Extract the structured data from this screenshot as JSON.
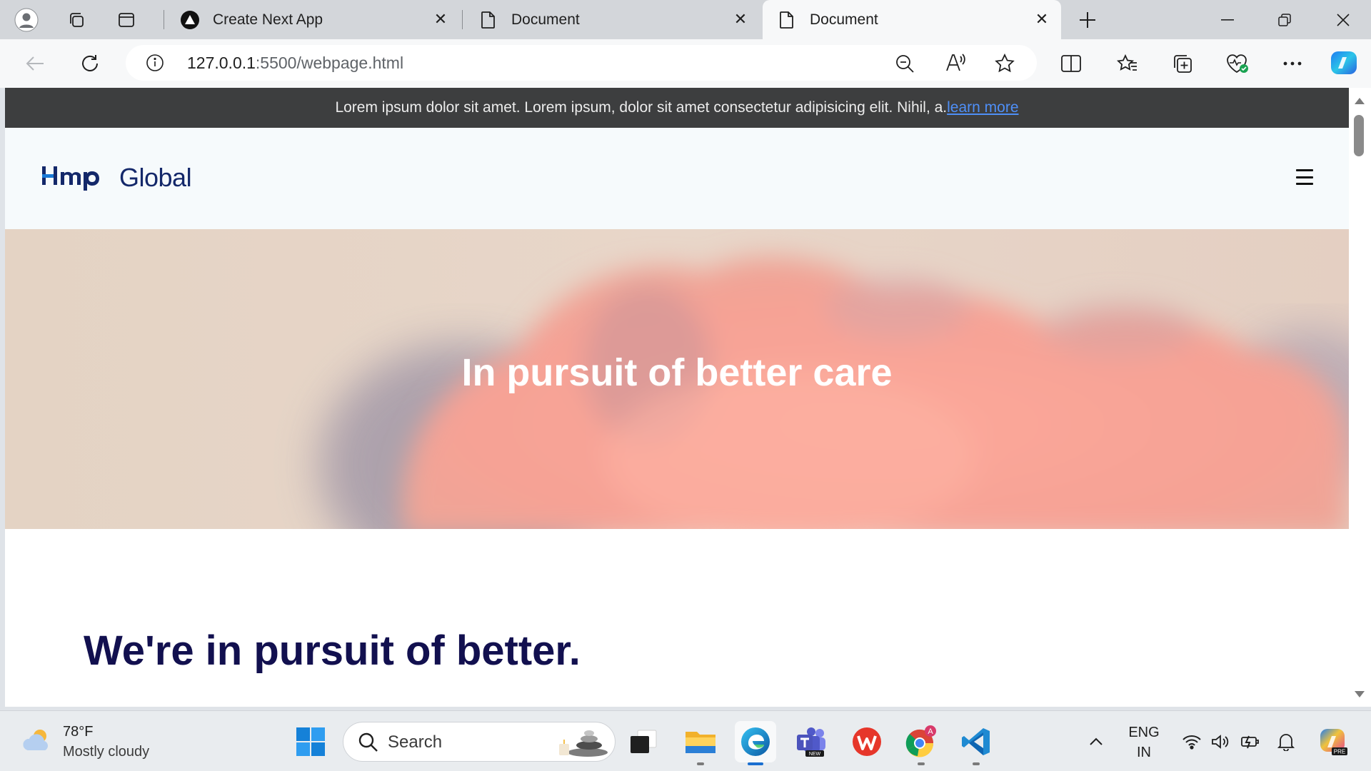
{
  "browser": {
    "tabs": [
      {
        "title": "Create Next App",
        "active": false
      },
      {
        "title": "Document",
        "active": false
      },
      {
        "title": "Document",
        "active": true
      }
    ],
    "address": {
      "host": "127.0.0.1",
      "rest": ":5500/webpage.html"
    }
  },
  "page": {
    "announcement": {
      "text": "Lorem ipsum dolor sit amet. Lorem ipsum, dolor sit amet consectetur adipisicing elit. Nihil, a.",
      "link": "learn more"
    },
    "logo_text": "Global",
    "hero_title": "In pursuit of better care",
    "section_title": "We're in pursuit of better."
  },
  "taskbar": {
    "weather": {
      "temp": "78°F",
      "condition": "Mostly cloudy"
    },
    "search_placeholder": "Search",
    "language": {
      "line1": "ENG",
      "line2": "IN"
    }
  },
  "colors": {
    "accent_link": "#4f8ff7",
    "brand_navy": "#14286a",
    "heading_navy": "#12104f",
    "announcement_bg": "#3d3e3f"
  }
}
